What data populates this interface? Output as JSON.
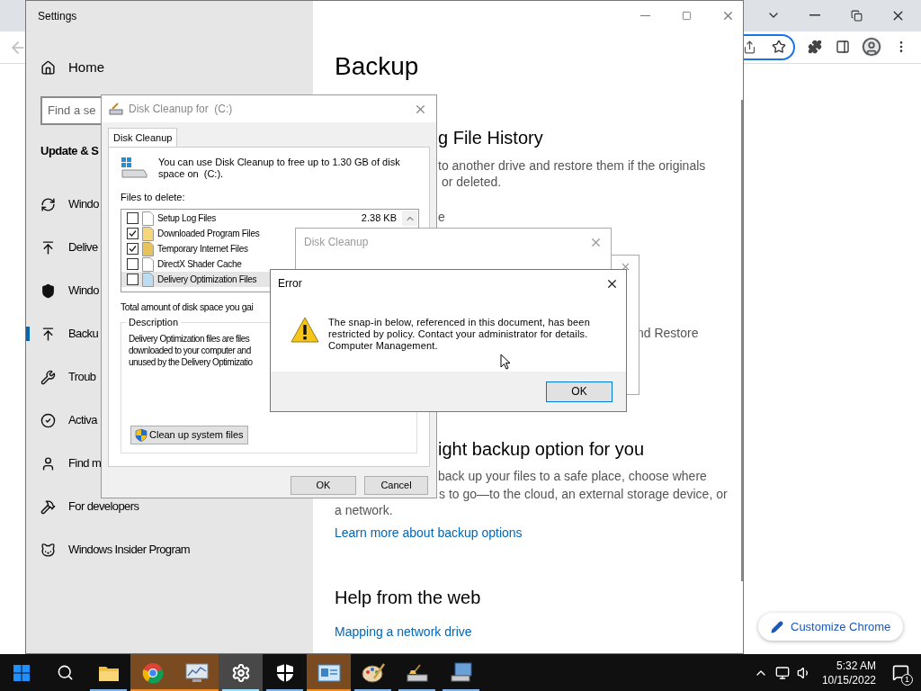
{
  "browser": {
    "customize_button": "Customize Chrome"
  },
  "settings": {
    "title": "Settings",
    "home": "Home",
    "search_placeholder": "Find a se",
    "section_title": "Update & S",
    "nav": [
      {
        "label": "Windo",
        "selected": false
      },
      {
        "label": "Delive",
        "selected": false
      },
      {
        "label": "Windo",
        "selected": false
      },
      {
        "label": "Backu",
        "selected": true
      },
      {
        "label": "Troub",
        "selected": false
      },
      {
        "label": "Activa",
        "selected": false
      },
      {
        "label": "Find m",
        "selected": false
      },
      {
        "label": "For developers",
        "selected": false
      },
      {
        "label": "Windows Insider Program",
        "selected": false
      }
    ],
    "content": [
      {
        "kind": "title",
        "text": "Backup"
      },
      {
        "kind": "heading",
        "text": "g File History"
      },
      {
        "kind": "text",
        "text": "to another drive and restore them if the originals"
      },
      {
        "kind": "text",
        "text": "or deleted."
      },
      {
        "kind": "text",
        "text": "e"
      },
      {
        "kind": "text",
        "text": "nd Restore"
      },
      {
        "kind": "heading",
        "text": "ight backup option for you"
      },
      {
        "kind": "text",
        "text": "back up your files to a safe place, choose where"
      },
      {
        "kind": "text",
        "text": "s to go—to the cloud, an external storage device, or"
      },
      {
        "kind": "text",
        "text": "a network."
      },
      {
        "kind": "link",
        "text": "Learn more about backup options"
      },
      {
        "kind": "heading",
        "text": "Help from the web"
      },
      {
        "kind": "link",
        "text": "Mapping a network drive"
      }
    ]
  },
  "disk_cleanup": {
    "title": "Disk Cleanup for  (C:)",
    "tab": "Disk Cleanup",
    "intro": "You can use Disk Cleanup to free up to 1.30 GB of disk space on  (C:).",
    "files_label": "Files to delete:",
    "files": [
      {
        "name": "Setup Log Files",
        "size": "2.38 KB",
        "checked": false,
        "selected": false
      },
      {
        "name": "Downloaded Program Files",
        "checked": true,
        "selected": false
      },
      {
        "name": "Temporary Internet Files",
        "checked": true,
        "selected": false
      },
      {
        "name": "DirectX Shader Cache",
        "checked": false,
        "selected": false
      },
      {
        "name": "Delivery Optimization Files",
        "checked": false,
        "selected": true
      }
    ],
    "total_label": "Total amount of disk space you gai",
    "description_title": "Description",
    "description_lines": [
      "Delivery Optimization files are files",
      "downloaded to your computer and",
      "unused by the Delivery Optimizatio"
    ],
    "system_button": "Clean up system files",
    "ok": "OK",
    "cancel": "Cancel"
  },
  "cleanup_prompt": {
    "title": "Disk Cleanup"
  },
  "error": {
    "title": "Error",
    "message": "The snap-in below, referenced in this document, has been restricted by policy. Contact your administrator for details. Computer Management.",
    "ok": "OK"
  },
  "taskbar": {
    "apps": [
      {
        "selected": false,
        "flashing": false,
        "running": true
      },
      {
        "selected": false,
        "flashing": true,
        "running": false
      },
      {
        "selected": false,
        "flashing": true,
        "running": false
      },
      {
        "selected": true,
        "flashing": false,
        "running": true
      },
      {
        "selected": false,
        "flashing": false,
        "running": true
      },
      {
        "selected": false,
        "flashing": true,
        "running": true
      },
      {
        "selected": false,
        "flashing": false,
        "running": true
      },
      {
        "selected": false,
        "flashing": false,
        "running": true
      },
      {
        "selected": false,
        "flashing": false,
        "running": true
      }
    ],
    "time": "5:32 AM",
    "date": "10/15/2022",
    "notifications": "1"
  }
}
